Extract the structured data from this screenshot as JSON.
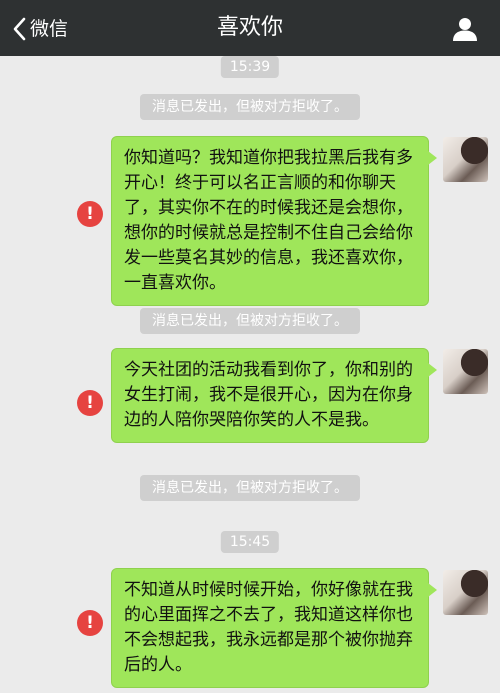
{
  "navbar": {
    "back_label": "微信",
    "title": "喜欢你"
  },
  "messages": [
    {
      "time": "15:39"
    },
    {
      "system": "消息已发出，但被对方拒收了。"
    },
    {
      "text": "你知道吗？我知道你把我拉黑后我有多开心！终于可以名正言顺的和你聊天了，其实你不在的时候我还是会想你，想你的时候就总是控制不住自己会给你发一些莫名其妙的信息，我还喜欢你，一直喜欢你。",
      "status": "!"
    },
    {
      "system": "消息已发出，但被对方拒收了。"
    },
    {
      "text": "今天社团的活动我看到你了，你和别的女生打闹，我不是很开心，因为在你身边的人陪你哭陪你笑的人不是我。",
      "status": "!"
    },
    {
      "system": "消息已发出，但被对方拒收了。"
    },
    {
      "time": "15:45"
    },
    {
      "text": "不知道从时候时候开始，你好像就在我的心里面挥之不去了，我知道这样你也不会想起我，我永远都是那个被你抛弃后的人。",
      "status": "!"
    }
  ],
  "colors": {
    "navbar_bg": "#2e3132",
    "chat_bg": "#ebebeb",
    "bubble_green": "#9fe65a",
    "alert_red": "#e64340",
    "timestamp_bg": "#cfcfcf"
  },
  "icons": {
    "back": "chevron-left-icon",
    "profile": "person-icon",
    "alert": "exclamation-circle-icon"
  }
}
